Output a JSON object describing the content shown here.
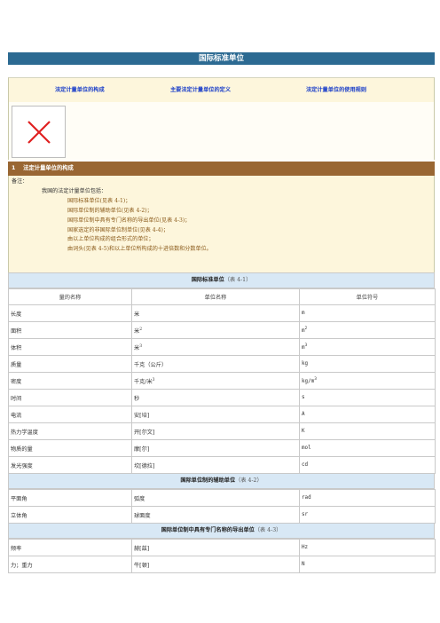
{
  "page": {
    "title": "国际标准单位"
  },
  "nav": {
    "link1": "法定计量单位的构成",
    "link2": "主要法定计量单位的定义",
    "link3": "法定计量单位的使用规则"
  },
  "section": {
    "number": "1",
    "title": "法定计量单位的构成"
  },
  "notes": {
    "label": "备注：",
    "lead": "我国的法定计量单位包括：",
    "items": [
      "国际标准单位(见表 4-1)；",
      "国际单位制的辅助单位(见表 4-2)；",
      "国际单位制中具有专门名称的导出单位(见表 4-3)；",
      "国家选定的非国际单位制单位(见表 4-4)；",
      "由以上单位构成的组合形式的单位；",
      "由词头(见表 4-5)和以上单位所构成的十进倍数和分数单位。"
    ]
  },
  "table1": {
    "title": "国际标准单位",
    "ref": "（表 4-1）",
    "headers": [
      "量的名称",
      "单位名称",
      "单位符号"
    ],
    "rows": [
      [
        "长度",
        "米",
        "m"
      ],
      [
        "面积",
        "米",
        "m"
      ],
      [
        "体积",
        "米",
        "m"
      ],
      [
        "质量",
        "千克（公斤）",
        "kg"
      ],
      [
        "密度",
        "千克/米",
        "kg/m"
      ],
      [
        "时间",
        "秒",
        "s"
      ],
      [
        "电流",
        "安[培]",
        "A"
      ],
      [
        "热力学温度",
        "开[尔文]",
        "K"
      ],
      [
        "物质的量",
        "摩[尔]",
        "mol"
      ],
      [
        "发光强度",
        "坎[德拉]",
        "cd"
      ]
    ],
    "superscripts": {
      "area": "2",
      "volume": "3",
      "density_name": "3",
      "density_symbol": "3"
    }
  },
  "table2": {
    "title": "国际单位制的辅助单位",
    "ref": "（表 4-2）",
    "rows": [
      [
        "平面角",
        "弧度",
        "rad"
      ],
      [
        "立体角",
        "球面度",
        "sr"
      ]
    ]
  },
  "table3": {
    "title": "国际单位制中具有专门名称的导出单位",
    "ref": "（表 4-3）",
    "rows": [
      [
        "频率",
        "赫[兹]",
        "Hz"
      ],
      [
        "力；重力",
        "牛[顿]",
        "N"
      ]
    ]
  },
  "colors": {
    "title_bar": "#2c6a92",
    "section_bar": "#996633",
    "notes_bg": "#fdf6dc",
    "table_header_bg": "#d8e8f5",
    "link": "#1a3ec9",
    "broken_image_x": "#e02020"
  }
}
